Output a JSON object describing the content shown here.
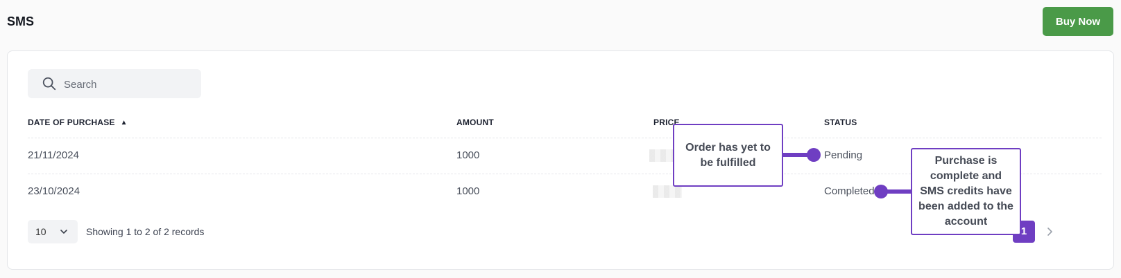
{
  "page": {
    "title": "SMS"
  },
  "header": {
    "buy_label": "Buy Now"
  },
  "search": {
    "placeholder": "Search"
  },
  "table": {
    "columns": {
      "date": "DATE OF PURCHASE",
      "amount": "AMOUNT",
      "price": "PRICE",
      "status": "STATUS"
    },
    "sort": {
      "column": "DATE OF PURCHASE",
      "direction": "ascending"
    },
    "rows": [
      {
        "date": "21/11/2024",
        "amount": "1000",
        "status": "Pending"
      },
      {
        "date": "23/10/2024",
        "amount": "1000",
        "status": "Completed"
      }
    ]
  },
  "pagination": {
    "page_size": "10",
    "records_text": "Showing 1 to 2 of 2 records",
    "current_page": "1"
  },
  "annotations": {
    "pending": "Order has yet to be fulfilled",
    "completed": "Purchase is complete and SMS credits have been added to the account"
  },
  "colors": {
    "accent": "#6f3ec2",
    "buy_button": "#4a9a48"
  },
  "icons": {
    "search": "search-icon",
    "sort": "sort-asc-icon",
    "page_size": "chevron-down-icon",
    "next": "chevron-right-icon"
  }
}
